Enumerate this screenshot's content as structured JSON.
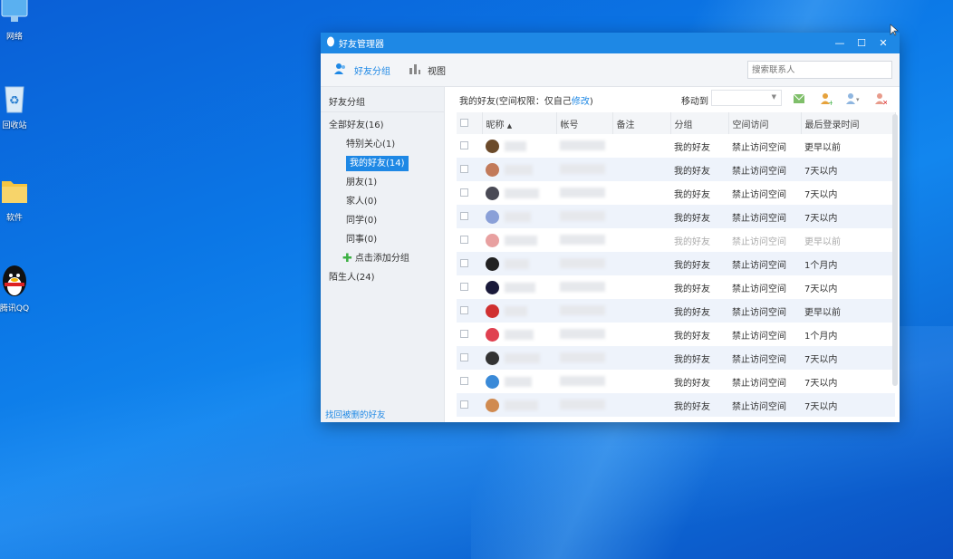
{
  "desktop": {
    "icons": [
      {
        "label": "网络",
        "icon": "network-icon"
      },
      {
        "label": "回收站",
        "icon": "recycle-bin-icon"
      },
      {
        "label": "软件",
        "icon": "folder-icon"
      },
      {
        "label": "腾讯QQ",
        "icon": "qq-penguin-icon"
      }
    ]
  },
  "window": {
    "title": "好友管理器",
    "controls": {
      "minimize": "—",
      "maximize": "☐",
      "close": "✕"
    }
  },
  "toolbar": {
    "friend_groups": "好友分组",
    "view": "视图",
    "search_placeholder": "搜索联系人"
  },
  "sidebar": {
    "header": "好友分组",
    "all_friends": "全部好友(16)",
    "groups": [
      {
        "label": "特别关心(1)",
        "selected": false
      },
      {
        "label": "我的好友(14)",
        "selected": true
      },
      {
        "label": "朋友(1)",
        "selected": false
      },
      {
        "label": "家人(0)",
        "selected": false
      },
      {
        "label": "同学(0)",
        "selected": false
      },
      {
        "label": "同事(0)",
        "selected": false
      }
    ],
    "add_group": "点击添加分组",
    "strangers": "陌生人(24)",
    "recover_link": "找回被删的好友"
  },
  "main": {
    "header_prefix": "我的好友(空间权限：仅自己",
    "header_link": "修改",
    "header_suffix": ")",
    "move_to": "移动到",
    "columns": {
      "nickname": "昵称",
      "sort_indicator": "▲",
      "account": "帐号",
      "remark": "备注",
      "group": "分组",
      "space_access": "空间访问",
      "last_login": "最后登录时间"
    },
    "rows": [
      {
        "group": "我的好友",
        "space": "禁止访问空间",
        "last": "更早以前",
        "avatar_color": "#6b4a2a",
        "faded": false
      },
      {
        "group": "我的好友",
        "space": "禁止访问空间",
        "last": "7天以内",
        "avatar_color": "#c27a5a",
        "faded": false
      },
      {
        "group": "我的好友",
        "space": "禁止访问空间",
        "last": "7天以内",
        "avatar_color": "#4a4a55",
        "faded": false
      },
      {
        "group": "我的好友",
        "space": "禁止访问空间",
        "last": "7天以内",
        "avatar_color": "#8aa0d8",
        "faded": false
      },
      {
        "group": "我的好友",
        "space": "禁止访问空间",
        "last": "更早以前",
        "avatar_color": "#e8a0a0",
        "faded": true
      },
      {
        "group": "我的好友",
        "space": "禁止访问空间",
        "last": "1个月内",
        "avatar_color": "#222222",
        "faded": false
      },
      {
        "group": "我的好友",
        "space": "禁止访问空间",
        "last": "7天以内",
        "avatar_color": "#1a1a3a",
        "faded": false
      },
      {
        "group": "我的好友",
        "space": "禁止访问空间",
        "last": "更早以前",
        "avatar_color": "#d03030",
        "faded": false
      },
      {
        "group": "我的好友",
        "space": "禁止访问空间",
        "last": "1个月内",
        "avatar_color": "#e04050",
        "faded": false
      },
      {
        "group": "我的好友",
        "space": "禁止访问空间",
        "last": "7天以内",
        "avatar_color": "#333333",
        "faded": false
      },
      {
        "group": "我的好友",
        "space": "禁止访问空间",
        "last": "7天以内",
        "avatar_color": "#3a8ad8",
        "faded": false
      },
      {
        "group": "我的好友",
        "space": "禁止访问空间",
        "last": "7天以内",
        "avatar_color": "#d08a50",
        "faded": false
      }
    ]
  },
  "colors": {
    "accent": "#1e88e5",
    "desktop": "#0b6fe0"
  }
}
